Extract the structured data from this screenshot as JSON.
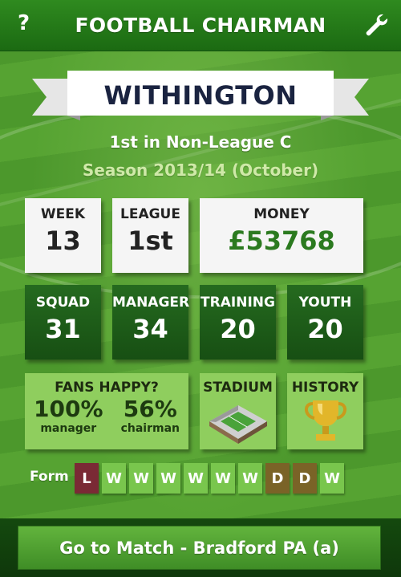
{
  "header": {
    "title": "FOOTBALL CHAIRMAN",
    "help_label": "?",
    "settings_icon": "wrench-icon"
  },
  "club": {
    "name": "WITHINGTON",
    "position_text": "1st in Non-League C",
    "season_text": "Season 2013/14 (October)"
  },
  "stats": {
    "week": {
      "label": "WEEK",
      "value": "13"
    },
    "league": {
      "label": "LEAGUE",
      "value": "1st"
    },
    "money": {
      "label": "MONEY",
      "value": "£53768"
    }
  },
  "ratings": {
    "squad": {
      "label": "SQUAD",
      "value": "31"
    },
    "manager": {
      "label": "MANAGER",
      "value": "34"
    },
    "training": {
      "label": "TRAINING",
      "value": "20"
    },
    "youth": {
      "label": "YOUTH",
      "value": "20"
    }
  },
  "fans": {
    "label": "FANS HAPPY?",
    "manager_pct": "100%",
    "manager_label": "manager",
    "chairman_pct": "56%",
    "chairman_label": "chairman"
  },
  "stadium": {
    "label": "STADIUM",
    "icon": "stadium-icon"
  },
  "history": {
    "label": "HISTORY",
    "icon": "trophy-icon"
  },
  "form": {
    "label": "Form",
    "results": [
      "L",
      "W",
      "W",
      "W",
      "W",
      "W",
      "W",
      "D",
      "D",
      "W"
    ]
  },
  "match_button": {
    "label": "Go to Match - Bradford PA (a)"
  },
  "colors": {
    "win": "#79c64d",
    "loss": "#7a2a35",
    "draw": "#7a6327",
    "dark_card": "#1f5e19",
    "navy_text": "#1a2340"
  }
}
